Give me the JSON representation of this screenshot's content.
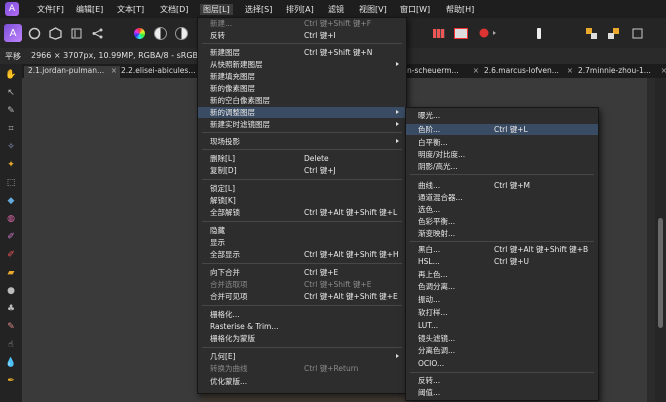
{
  "menubar": {
    "items": [
      "文件[F]",
      "编辑[E]",
      "文本[T]",
      "文档[D]",
      "图层[L]",
      "选择[S]",
      "排列[A]",
      "滤镜",
      "视图[V]",
      "窗口[W]",
      "帮助[H]"
    ],
    "active_index": 4
  },
  "context_bar": {
    "tool_label": "平移",
    "doc_info": "2966 × 3707px, 10.99MP, RGBA/8 - sRGB IEC"
  },
  "tabs": [
    {
      "label": "2.1.jordan-pulman..."
    },
    {
      "label": "2.2.elisei-abicules..."
    },
    {
      "label": "ven-scheuerm..."
    },
    {
      "label": "2.6.marcus-lofven..."
    },
    {
      "label": "2.7minnie-zhou-1..."
    }
  ],
  "layer_menu": {
    "items": [
      {
        "label": "新建...",
        "shortcut": "Ctrl 键+Shift 键+F",
        "disabled": true
      },
      {
        "label": "反转",
        "shortcut": "Ctrl 键+I"
      },
      {
        "label": "新建图层",
        "shortcut": "Ctrl 键+Shift 键+N"
      },
      {
        "label": "从快照新建图层",
        "submenu": true
      },
      {
        "label": "新建填充图层"
      },
      {
        "label": "新的像素图层"
      },
      {
        "label": "新的空白像素图层"
      },
      {
        "label": "新的调整图层",
        "submenu": true,
        "highlighted": true
      },
      {
        "label": "新建实时滤镜图层",
        "submenu": true
      },
      {
        "label": "现场投影",
        "submenu": true
      },
      {
        "label": "删除[L]",
        "shortcut": "Delete"
      },
      {
        "label": "复制[D]",
        "shortcut": "Ctrl 键+J"
      },
      {
        "label": "锁定[L]"
      },
      {
        "label": "解锁[K]"
      },
      {
        "label": "全部解锁",
        "shortcut": "Ctrl 键+Alt 键+Shift 键+L"
      },
      {
        "label": "隐藏"
      },
      {
        "label": "显示"
      },
      {
        "label": "全部显示",
        "shortcut": "Ctrl 键+Alt 键+Shift 键+H"
      },
      {
        "label": "向下合并",
        "shortcut": "Ctrl 键+E"
      },
      {
        "label": "合并选取项",
        "shortcut": "Ctrl 键+Shift 键+E",
        "disabled": true
      },
      {
        "label": "合并可见项",
        "shortcut": "Ctrl 键+Alt 键+Shift 键+E"
      },
      {
        "label": "栅格化..."
      },
      {
        "label": "Rasterise & Trim..."
      },
      {
        "label": "栅格化为蒙版"
      },
      {
        "label": "几何[E]",
        "submenu": true
      },
      {
        "label": "转换为曲线",
        "shortcut": "Ctrl 键+Return",
        "disabled": true
      },
      {
        "label": "优化蒙版..."
      }
    ]
  },
  "adjust_submenu": {
    "items": [
      {
        "label": "曝光..."
      },
      {
        "label": "色阶...",
        "shortcut": "Ctrl 键+L",
        "highlighted": true
      },
      {
        "label": "白平衡..."
      },
      {
        "label": "明度/对比度..."
      },
      {
        "label": "阴影/高光..."
      },
      {
        "label": "曲线...",
        "shortcut": "Ctrl 键+M"
      },
      {
        "label": "通道混合器..."
      },
      {
        "label": "选色..."
      },
      {
        "label": "色彩平衡..."
      },
      {
        "label": "渐变映射..."
      },
      {
        "label": "黑白...",
        "shortcut": "Ctrl 键+Alt 键+Shift 键+B"
      },
      {
        "label": "HSL...",
        "shortcut": "Ctrl 键+U"
      },
      {
        "label": "再上色..."
      },
      {
        "label": "色调分离..."
      },
      {
        "label": "振动..."
      },
      {
        "label": "软打样..."
      },
      {
        "label": "LUT..."
      },
      {
        "label": "镜头滤镜..."
      },
      {
        "label": "分离色调..."
      },
      {
        "label": "OCIO..."
      },
      {
        "label": "反转..."
      },
      {
        "label": "阈值..."
      }
    ]
  },
  "colors": {
    "highlight": "#3a4c64",
    "accent": "#8a5ad8"
  }
}
